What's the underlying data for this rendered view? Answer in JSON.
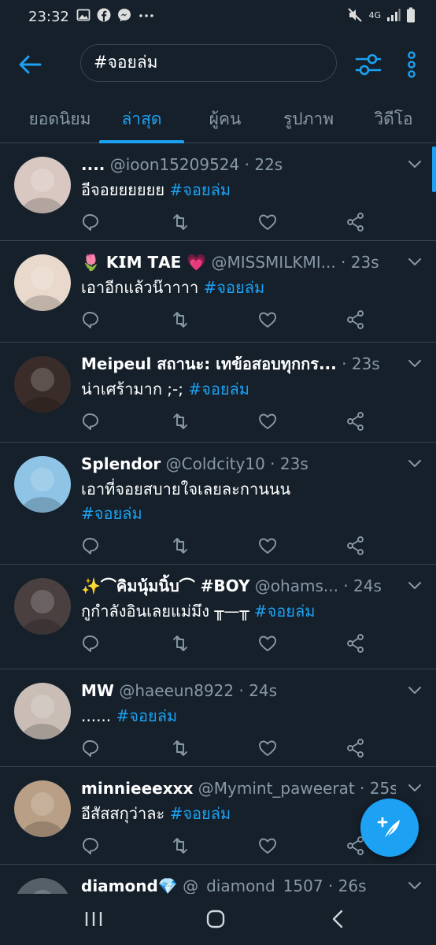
{
  "status_bar": {
    "time": "23:32",
    "network": "4G"
  },
  "search": {
    "query": "#จอยล่ม"
  },
  "tabs": [
    {
      "label": "ยอดนิยม",
      "active": false
    },
    {
      "label": "ล่าสุด",
      "active": true
    },
    {
      "label": "ผู้คน",
      "active": false
    },
    {
      "label": "รูปภาพ",
      "active": false
    },
    {
      "label": "วิดีโอ",
      "active": false
    }
  ],
  "tweets": [
    {
      "name": "....",
      "handle": "@ioon15209524",
      "time": "22s",
      "text": "อีจอยยยยยย",
      "hashtag": "#จอยล่ม",
      "avatar_color": "#d9c8c2"
    },
    {
      "name": "🌷 𝗞𝗜𝗠 𝗧𝗔𝗘 💗",
      "handle": "@MISSMILKMI...",
      "time": "23s",
      "text": "เอาอีกแล้วน๊าาาา",
      "hashtag": "#จอยล่ม",
      "avatar_color": "#e8d9cc"
    },
    {
      "name": "Meipeul สถานะ: เทข้อสอบทุกกร...",
      "handle": "",
      "time": "23s",
      "text": "น่าเศร้ามาก ;-;",
      "hashtag": "#จอยล่ม",
      "avatar_color": "#3a2c28"
    },
    {
      "name": "Splendor",
      "handle": "@Coldcity10",
      "time": "23s",
      "text": "เอาที่จอยสบายใจเลยละกานนน",
      "hashtag": "#จอยล่ม",
      "avatar_color": "#8fc4e6"
    },
    {
      "name": "✨⌒คิมนุ้มนิ้บ⌒ #BOY",
      "handle": "@ohams...",
      "time": "24s",
      "text": "กูกำลังอินเลยแม่มึง ╥—╥",
      "hashtag": "#จอยล่ม",
      "avatar_color": "#4a4040"
    },
    {
      "name": "MW",
      "handle": "@haeeun8922",
      "time": "24s",
      "text": "......",
      "hashtag": "#จอยล่ม",
      "avatar_color": "#c9bdb6"
    },
    {
      "name": "minnieeexxx",
      "handle": "@Mymint_paweerat",
      "time": "25s",
      "text": "อีสัสสกุว่าละ",
      "hashtag": "#จอยล่ม",
      "avatar_color": "#b89f86"
    },
    {
      "name": "diamond💎",
      "handle": "@_diamond_1507",
      "time": "26s",
      "text": "",
      "hashtag": "",
      "avatar_color": "#566068"
    }
  ],
  "colors": {
    "accent": "#1da1f2",
    "background": "#15202b",
    "secondary_text": "#8899a6",
    "divider": "#38444d"
  }
}
